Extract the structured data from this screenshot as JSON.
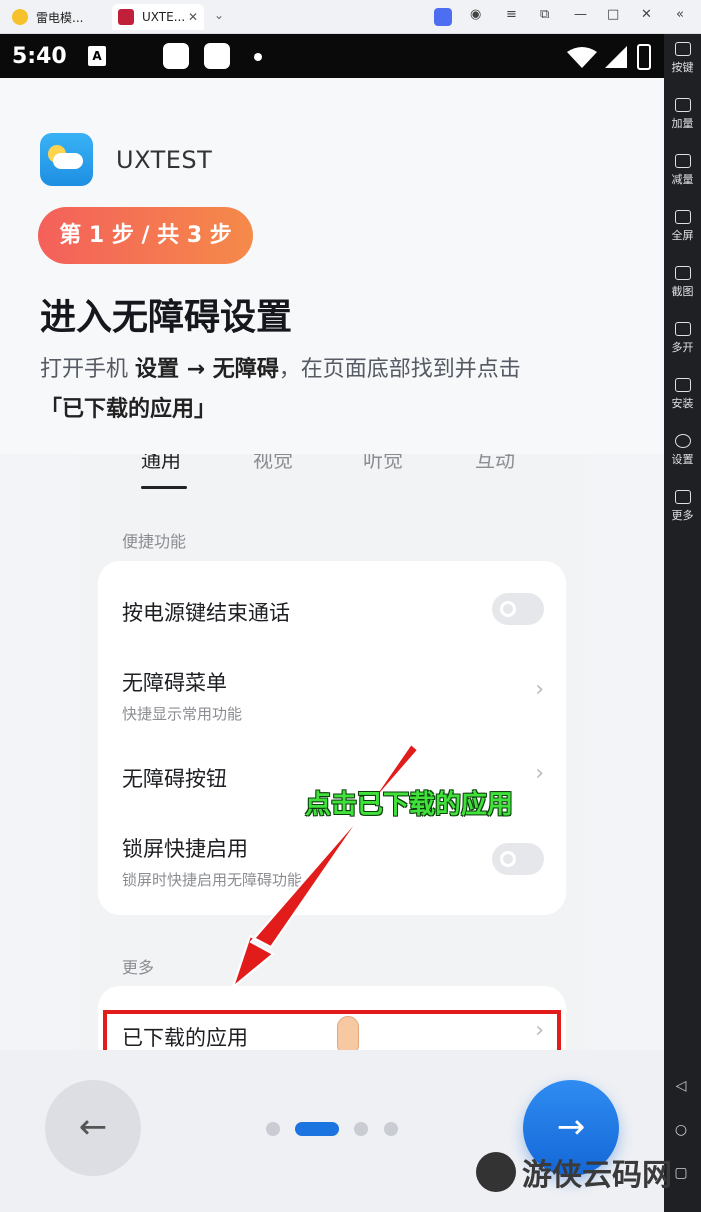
{
  "browser": {
    "tabs": [
      {
        "label": "雷电模...",
        "icon": "ldplayer-icon"
      },
      {
        "label": "UXTE...",
        "icon": "app-tab-icon"
      }
    ],
    "window_controls": [
      "lightning-icon",
      "account-icon",
      "menu-icon",
      "minimize-icon",
      "restore-icon",
      "close-icon",
      "collapse-icon"
    ]
  },
  "status_bar": {
    "time": "5:40",
    "badge": "A"
  },
  "sidebar": {
    "items": [
      {
        "label": "按键",
        "icon": "keyboard-icon"
      },
      {
        "label": "加量",
        "icon": "volume-up-icon"
      },
      {
        "label": "减量",
        "icon": "volume-down-icon"
      },
      {
        "label": "全屏",
        "icon": "fullscreen-icon"
      },
      {
        "label": "截图",
        "icon": "scissors-icon"
      },
      {
        "label": "多开",
        "icon": "multi-instance-icon"
      },
      {
        "label": "安装",
        "icon": "apk-install-icon"
      },
      {
        "label": "设置",
        "icon": "settings-icon"
      },
      {
        "label": "更多",
        "icon": "more-icon"
      }
    ]
  },
  "header": {
    "app_name": "UXTEST",
    "step_label": "第 1 步 / 共 3 步",
    "title": "进入无障碍设置",
    "desc_prefix": "打开手机 ",
    "desc_bold": "设置 → 无障碍",
    "desc_suffix": "，在页面底部找到并点击",
    "desc_line2": "「已下载的应用」"
  },
  "screenshot": {
    "tabs": [
      "通用",
      "视觉",
      "听觉",
      "互动"
    ],
    "section1": "便捷功能",
    "rows": [
      {
        "title": "按电源键结束通话",
        "sub": "",
        "control": "toggle"
      },
      {
        "title": "无障碍菜单",
        "sub": "快捷显示常用功能",
        "control": "chevron"
      },
      {
        "title": "无障碍按钮",
        "sub": "",
        "control": "chevron"
      },
      {
        "title": "锁屏快捷启用",
        "sub": "锁屏时快捷启用无障碍功能",
        "control": "toggle"
      }
    ],
    "section2": "更多",
    "target_row": "已下载的应用",
    "callout": "点击已下载的应用"
  },
  "footer": {
    "back_icon": "arrow-left-icon",
    "next_icon": "arrow-right-icon",
    "pagination": {
      "total": 4,
      "active": 2
    }
  },
  "watermark": "游侠云码网"
}
